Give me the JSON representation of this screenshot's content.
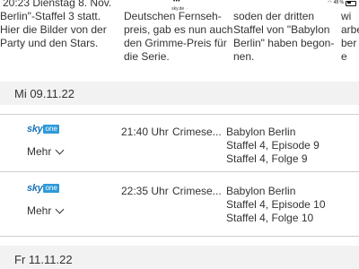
{
  "statusbar": {
    "time": "20:23",
    "date": "Dienstag 8. Nov.",
    "battery": "48 %",
    "dots": "•••"
  },
  "urlbar": {
    "url": "sky.de"
  },
  "top_columns": {
    "col1": [
      "Berlin\"-Staffel 3 statt.",
      "Hier die Bilder von der",
      "Party und den Stars."
    ],
    "col2": [
      "Deutschen Fernseh-",
      "preis, gab es nun auch",
      "den Grimme-Preis für",
      "die Serie."
    ],
    "col3": [
      "soden der dritten",
      "Staffel von \"Babylon",
      "Berlin\" haben begon-",
      "nen."
    ],
    "col4": [
      "wi",
      "arbe",
      "ber",
      "e"
    ]
  },
  "days": [
    {
      "label": "Mi 09.11.22",
      "items": [
        {
          "channel": {
            "brand": "sky",
            "badge": "one"
          },
          "more_label": "Mehr",
          "time": "21:40 Uhr",
          "genre": "Crimese...",
          "title_lines": [
            "Babylon Berlin",
            "Staffel 4, Episode 9",
            "Staffel 4, Folge 9"
          ]
        },
        {
          "channel": {
            "brand": "sky",
            "badge": "one"
          },
          "more_label": "Mehr",
          "time": "22:35 Uhr",
          "genre": "Crimese...",
          "title_lines": [
            "Babylon Berlin",
            "Staffel 4, Episode 10",
            "Staffel 4, Folge 10"
          ]
        }
      ]
    },
    {
      "label": "Fr 11.11.22",
      "items": []
    }
  ],
  "colors": {
    "sky_blue": "#1a74b8",
    "one_badge": "#2f9ad8",
    "day_bar": "#f2f2f2"
  }
}
